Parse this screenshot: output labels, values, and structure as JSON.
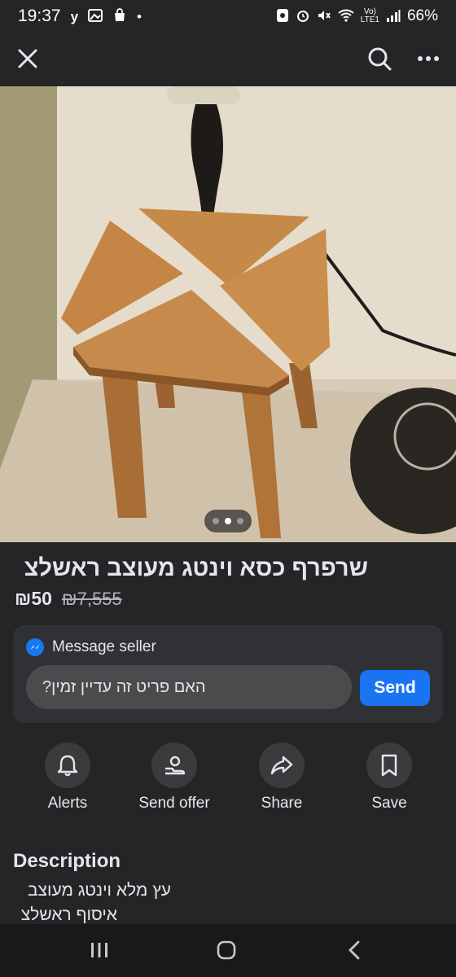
{
  "status_bar": {
    "time": "19:37",
    "left_icons": [
      "y",
      "gallery-icon",
      "bag-icon",
      "dot"
    ],
    "battery": "66%",
    "right_icons": [
      "recycle-icon",
      "alarm-icon",
      "mute-icon",
      "wifi-icon",
      "volte-icon",
      "signal-icon"
    ]
  },
  "app_bar": {
    "close_icon": "close-icon",
    "search_icon": "search-icon",
    "more_icon": "more-icon"
  },
  "photo": {
    "description": "",
    "page_count": 3,
    "active_page": 2
  },
  "listing": {
    "title": "שרפרף כסא וינטג מעוצב ראשלצ",
    "price": "₪50",
    "old_price": "₪7,555"
  },
  "message_card": {
    "header": "Message seller",
    "input_value": "האם פריט זה עדיין זמין?",
    "send_label": "Send"
  },
  "actions": [
    {
      "icon": "bell-icon",
      "label": "Alerts"
    },
    {
      "icon": "send-offer-icon",
      "label": "Send offer"
    },
    {
      "icon": "share-icon",
      "label": "Share"
    },
    {
      "icon": "bookmark-icon",
      "label": "Save"
    }
  ],
  "description": {
    "title": "Description",
    "lines": [
      "עץ מלא וינטג מעוצב",
      "איסוף ראשלצ"
    ]
  },
  "colors": {
    "background": "#242526",
    "card": "#303134",
    "accent": "#1a74f2",
    "text": "#e4e6eb"
  }
}
